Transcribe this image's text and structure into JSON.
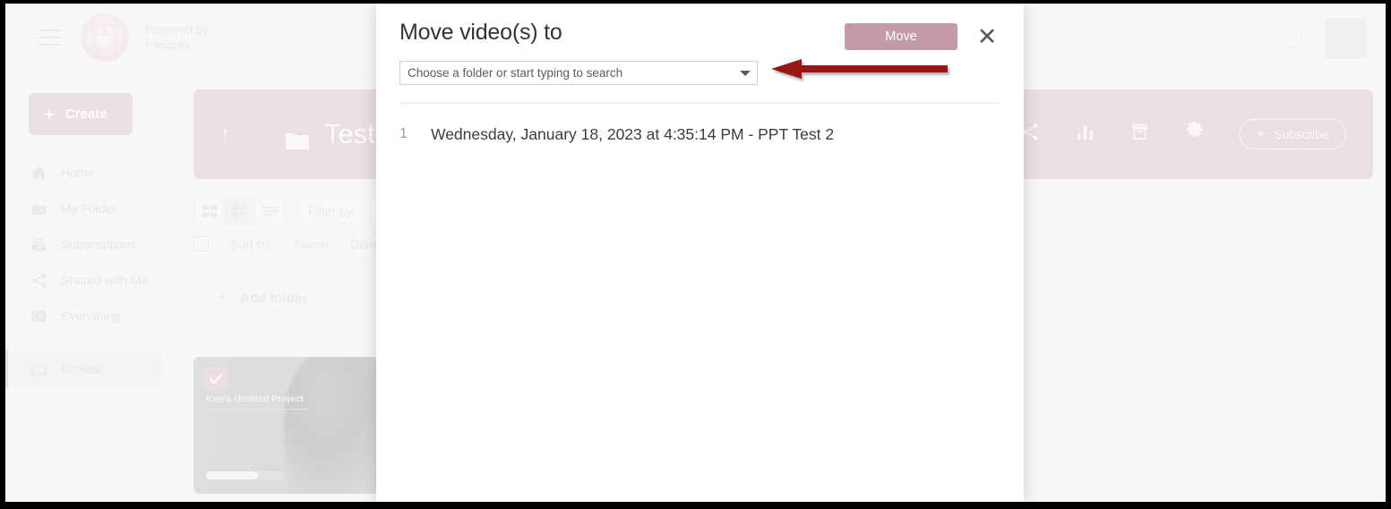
{
  "topbar": {
    "menu_icon": "hamburger-menu-icon",
    "logo": "university-seal-logo",
    "powered_line1": "Powered by",
    "powered_line2": "Panopto",
    "help_label": "?",
    "help_icon": "help-circle-icon",
    "avatar": "user-avatar"
  },
  "sidebar": {
    "create_label": "Create",
    "create_plus": "+",
    "items": [
      {
        "label": "Home",
        "icon": "home-icon"
      },
      {
        "label": "My Folder",
        "icon": "folder-star-icon"
      },
      {
        "label": "Subscriptions",
        "icon": "subscriptions-icon"
      },
      {
        "label": "Shared with Me",
        "icon": "share-nodes-icon"
      },
      {
        "label": "Everything",
        "icon": "video-library-icon"
      }
    ],
    "browse": {
      "label": "Browse",
      "icon": "folder-icon",
      "selected": true
    }
  },
  "folder_header": {
    "up_arrow_icon": "arrow-up-icon",
    "folder_icon": "folder-icon",
    "title": "Test V",
    "actions": [
      {
        "name": "share-icon"
      },
      {
        "name": "stats-bar-chart-icon"
      },
      {
        "name": "archive-icon"
      },
      {
        "name": "settings-gear-icon"
      }
    ],
    "subscribe_label": "Subscribe",
    "subscribe_plus": "+"
  },
  "toolbar": {
    "views": [
      {
        "name": "grid-view-icon",
        "active": false
      },
      {
        "name": "detail-list-view-icon",
        "active": true
      },
      {
        "name": "compact-list-view-icon",
        "active": false
      }
    ],
    "filter_placeholder": "Filter by ...",
    "select_all_checkbox": "select-all-checkbox",
    "sort_by_label": "Sort by:",
    "sort_options": [
      "Name",
      "Duration"
    ]
  },
  "add_folder": {
    "plus": "+",
    "label": "Add folder"
  },
  "video_card": {
    "title": "Ken's Untitled Project",
    "checked": true,
    "progress_percent": 66
  },
  "modal": {
    "title": "Move video(s) to",
    "move_label": "Move",
    "close_label": "✕",
    "folder_select_placeholder": "Choose a folder or start typing to search",
    "caret_icon": "chevron-down-icon",
    "videos": [
      {
        "index": "1",
        "name": "Wednesday, January 18, 2023 at 4:35:14 PM - PPT Test 2"
      }
    ]
  },
  "annotation": {
    "arrow_icon": "red-left-arrow-annotation",
    "arrow_color": "#991616"
  },
  "colors": {
    "accent_mauve": "#cfadb7",
    "hero_mauve": "#c9aab4",
    "move_button": "#c49aa8",
    "app_background": "#eaeaea",
    "modal_background": "#ffffff",
    "annotation_red": "#991616"
  }
}
